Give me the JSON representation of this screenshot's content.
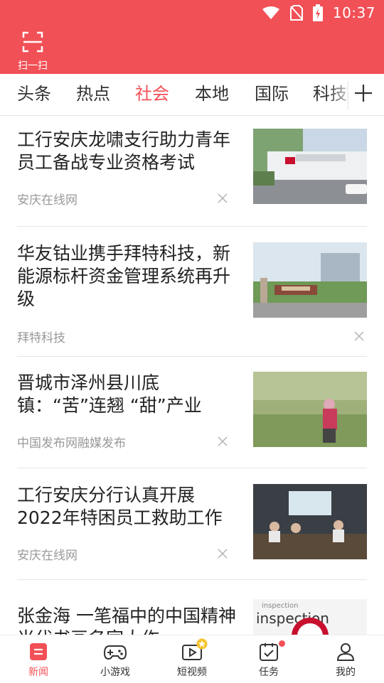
{
  "status_bar": {
    "time": "10:37",
    "icons": [
      "wifi-icon",
      "no-sim-icon",
      "battery-charging-icon"
    ]
  },
  "header": {
    "scan_label": "扫一扫",
    "bg_color": "#f25057"
  },
  "tabs": [
    {
      "label": "头条"
    },
    {
      "label": "热点"
    },
    {
      "label": "社会",
      "active": true
    },
    {
      "label": "本地"
    },
    {
      "label": "国际"
    },
    {
      "label": "科技"
    }
  ],
  "feed": [
    {
      "title": "工行安庆龙啸支行助力青年员工备战专业资格考试",
      "source": "安庆在线网"
    },
    {
      "title": "华友钴业携手拜特科技，新能源标杆资金管理系统再升级",
      "source": "拜特科技"
    },
    {
      "title": "晋城市泽州县川底镇：“苦”连翘 “甜”产业",
      "source": "中国发布网融媒发布"
    },
    {
      "title": "工行安庆分行认真开展2022年特困员工救助工作",
      "source": "安庆在线网"
    },
    {
      "title": "张金海 一笔福中的中国精神 当代书画名家大作",
      "source": ""
    }
  ],
  "bottom_nav": [
    {
      "label": "新闻",
      "icon": "news-icon",
      "active": true
    },
    {
      "label": "小游戏",
      "icon": "gamepad-icon"
    },
    {
      "label": "短视频",
      "icon": "video-icon"
    },
    {
      "label": "任务",
      "icon": "task-icon"
    },
    {
      "label": "我的",
      "icon": "profile-icon"
    }
  ],
  "colors": {
    "accent": "#f25057",
    "text_secondary": "#999999"
  }
}
